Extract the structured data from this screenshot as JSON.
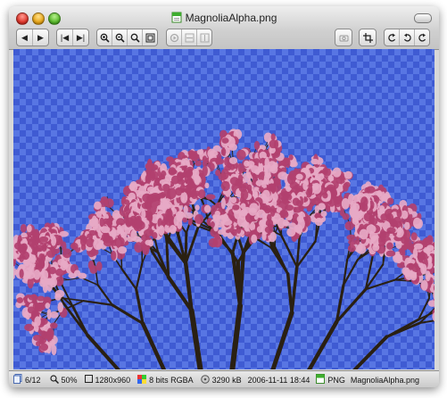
{
  "window": {
    "title": "MagnoliaAlpha.png"
  },
  "toolbar": {
    "groups": [
      {
        "name": "navigation",
        "buttons": [
          "previous-icon",
          "next-icon"
        ]
      },
      {
        "name": "first-last",
        "buttons": [
          "first-icon",
          "last-icon"
        ]
      },
      {
        "name": "zoom",
        "buttons": [
          "zoom-in-icon",
          "zoom-out-icon",
          "zoom-fit-icon",
          "zoom-actual-icon"
        ]
      },
      {
        "name": "slideshow",
        "buttons": [
          "slideshow-icon",
          "fit-width-icon",
          "fit-height-icon"
        ]
      },
      {
        "name": "viewer",
        "buttons": [
          "open-viewer-icon"
        ]
      },
      {
        "name": "crop",
        "buttons": [
          "crop-icon"
        ]
      },
      {
        "name": "rotate",
        "buttons": [
          "rotate-left-icon",
          "flip-icon",
          "rotate-right-icon"
        ]
      }
    ]
  },
  "image": {
    "subject": "magnolia tree with pink blossoms against transparent checkered background",
    "colors": {
      "sky": "#3f5bd3",
      "blossom": "#b2406f",
      "branch": "#2a2012"
    }
  },
  "status": {
    "index": "6/12",
    "zoom": "50%",
    "dimensions": "1280x960",
    "color_depth": "8 bits RGBA",
    "file_size": "3290 kB",
    "date": "2006-11-11 18:44",
    "format": "PNG",
    "filename": "MagnoliaAlpha.png"
  }
}
